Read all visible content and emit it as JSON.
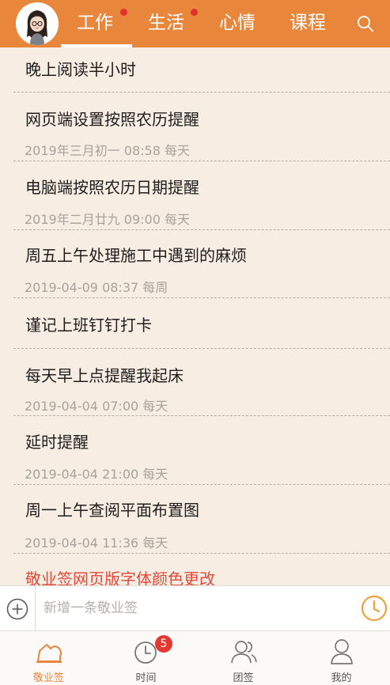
{
  "header": {
    "tabs": [
      {
        "label": "工作",
        "active": true,
        "has_dot": true
      },
      {
        "label": "生活",
        "active": false,
        "has_dot": true
      },
      {
        "label": "心情",
        "active": false,
        "has_dot": false
      },
      {
        "label": "课程",
        "active": false,
        "has_dot": false
      }
    ],
    "search_icon": "search-icon",
    "accent_color": "#e8873c",
    "dot_color": "#e3312c"
  },
  "list": {
    "items": [
      {
        "title": "晚上阅读半小时",
        "sub": ""
      },
      {
        "title": "网页端设置按照农历提醒",
        "sub": "2019年三月初一 08:58 每天"
      },
      {
        "title": "电脑端按照农历日期提醒",
        "sub": "2019年二月廿九 09:00 每天"
      },
      {
        "title": "周五上午处理施工中遇到的麻烦",
        "sub": "2019-04-09 08:37 每周"
      },
      {
        "title": "谨记上班钉钉打卡",
        "sub": ""
      },
      {
        "title": "每天早上点提醒我起床",
        "sub": "2019-04-04 07:00 每天"
      },
      {
        "title": "延时提醒",
        "sub": "2019-04-04 21:00 每天"
      },
      {
        "title": "周一上午查阅平面布置图",
        "sub": "2019-04-04 11:36 每天"
      },
      {
        "title": "敬业签网页版字体颜色更改",
        "sub": "",
        "color": "#e24a3c"
      }
    ]
  },
  "input": {
    "placeholder": "新增一条敬业签",
    "add_icon": "plus-circle-icon",
    "clock_icon": "clock-icon"
  },
  "nav": {
    "items": [
      {
        "label": "敬业签",
        "icon": "cloud-tag-icon",
        "active": true
      },
      {
        "label": "时间",
        "icon": "clock-icon",
        "badge": "5"
      },
      {
        "label": "团签",
        "icon": "group-icon"
      },
      {
        "label": "我的",
        "icon": "person-icon"
      }
    ]
  }
}
